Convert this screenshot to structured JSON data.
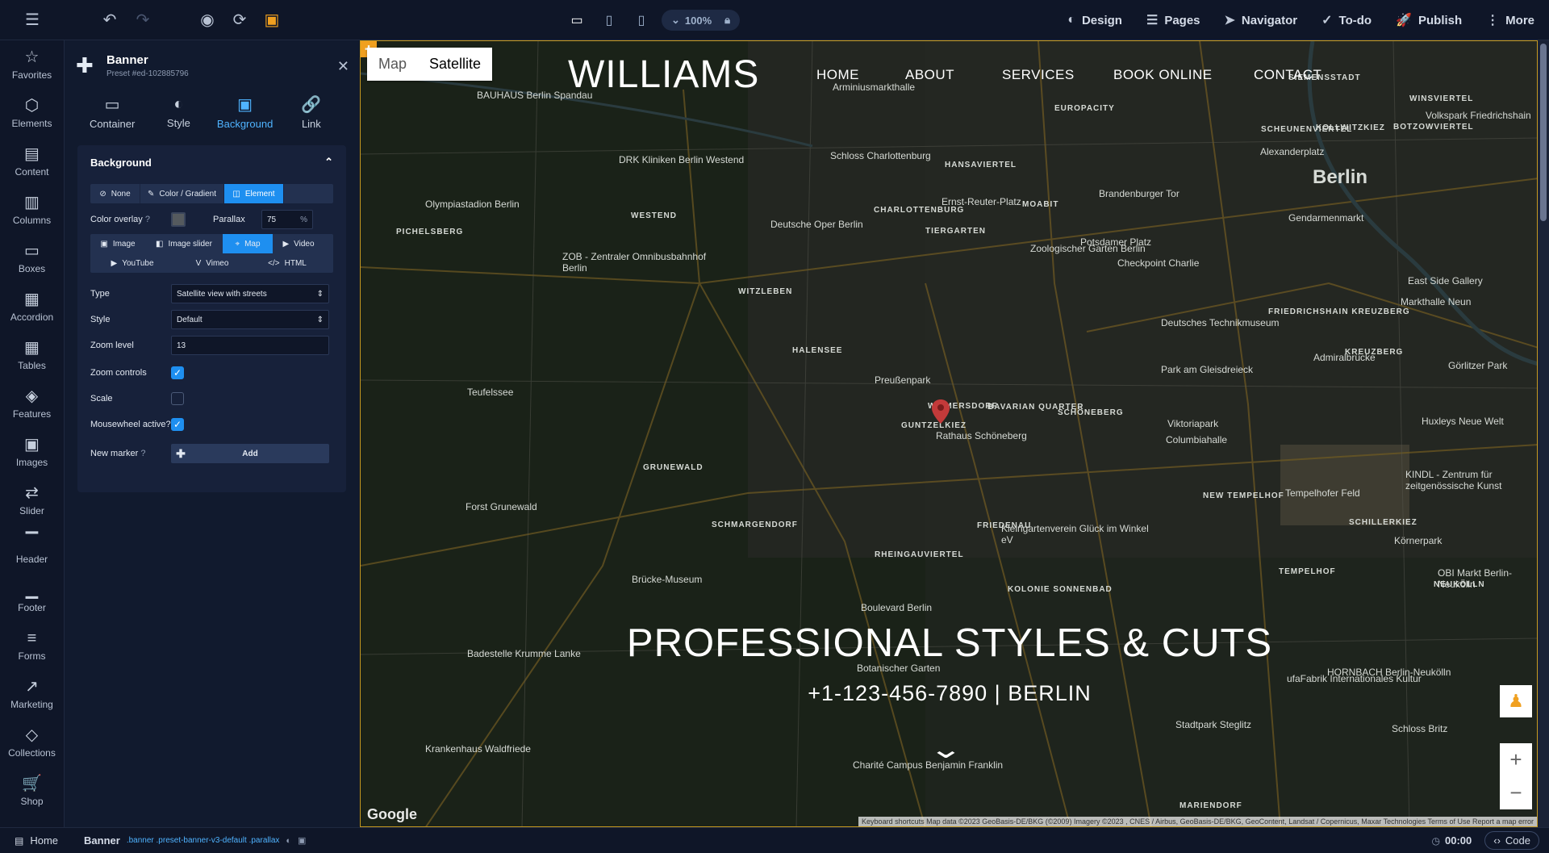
{
  "toolbar": {
    "zoom": "100%",
    "nav": [
      {
        "icon": "palette-icon",
        "glyph": "◐",
        "label": "Design"
      },
      {
        "icon": "pages-icon",
        "glyph": "☰",
        "label": "Pages"
      },
      {
        "icon": "navigator-icon",
        "glyph": "➤",
        "label": "Navigator"
      },
      {
        "icon": "check-circle-icon",
        "glyph": "✓",
        "label": "To-do"
      },
      {
        "icon": "rocket-icon",
        "glyph": "🚀",
        "label": "Publish"
      },
      {
        "icon": "more-icon",
        "glyph": "⋮",
        "label": "More"
      }
    ]
  },
  "rail": [
    {
      "icon": "star-icon",
      "glyph": "☆",
      "label": "Favorites"
    },
    {
      "icon": "cube-icon",
      "glyph": "⬡",
      "label": "Elements"
    },
    {
      "icon": "document-icon",
      "glyph": "▤",
      "label": "Content"
    },
    {
      "icon": "columns-icon",
      "glyph": "▥",
      "label": "Columns"
    },
    {
      "icon": "box-icon",
      "glyph": "▭",
      "label": "Boxes"
    },
    {
      "icon": "accordion-icon",
      "glyph": "▦",
      "label": "Accordion"
    },
    {
      "icon": "table-icon",
      "glyph": "▦",
      "label": "Tables"
    },
    {
      "icon": "features-icon",
      "glyph": "◈",
      "label": "Features"
    },
    {
      "icon": "image-icon",
      "glyph": "▣",
      "label": "Images"
    },
    {
      "icon": "slider-icon",
      "glyph": "⇄",
      "label": "Slider"
    },
    {
      "icon": "header-icon",
      "glyph": "▔",
      "label": "Header"
    },
    {
      "icon": "footer-icon",
      "glyph": "▁",
      "label": "Footer"
    },
    {
      "icon": "forms-icon",
      "glyph": "≡",
      "label": "Forms"
    },
    {
      "icon": "marketing-icon",
      "glyph": "↗",
      "label": "Marketing"
    },
    {
      "icon": "layers-icon",
      "glyph": "◇",
      "label": "Collections"
    },
    {
      "icon": "cart-icon",
      "glyph": "🛒",
      "label": "Shop"
    }
  ],
  "panel": {
    "title": "Banner",
    "subtitle": "Preset #ed-102885796",
    "tabs": [
      {
        "label": "Container",
        "glyph": "▭",
        "icon": "container-icon"
      },
      {
        "label": "Style",
        "glyph": "◐",
        "icon": "palette-icon"
      },
      {
        "label": "Background",
        "glyph": "▣",
        "icon": "background-icon"
      },
      {
        "label": "Link",
        "glyph": "🔗",
        "icon": "link-icon"
      }
    ],
    "section_title": "Background",
    "bg_modes": [
      {
        "label": "None",
        "glyph": "⊘"
      },
      {
        "label": "Color / Gradient",
        "glyph": "✎"
      },
      {
        "label": "Element",
        "glyph": "◫"
      }
    ],
    "color_overlay_label": "Color overlay",
    "parallax_label": "Parallax",
    "parallax_value": "75",
    "parallax_unit": "%",
    "types_row1": [
      {
        "label": "Image",
        "glyph": "▣"
      },
      {
        "label": "Image slider",
        "glyph": "◧"
      },
      {
        "label": "Map",
        "glyph": "⌖"
      },
      {
        "label": "Video",
        "glyph": "▶"
      }
    ],
    "types_row2": [
      {
        "label": "YouTube",
        "glyph": "▶"
      },
      {
        "label": "Vimeo",
        "glyph": "V"
      },
      {
        "label": "HTML",
        "glyph": "</>"
      }
    ],
    "type_label": "Type",
    "type_value": "Satellite view with streets",
    "style_label": "Style",
    "style_value": "Default",
    "zoom_label": "Zoom level",
    "zoom_value": "13",
    "zoom_controls_label": "Zoom controls",
    "scale_label": "Scale",
    "mousewheel_label": "Mousewheel active?",
    "new_marker_label": "New marker",
    "add_label": "Add"
  },
  "site": {
    "logo": "WILLIAMS",
    "nav": [
      "HOME",
      "ABOUT",
      "SERVICES",
      "BOOK ONLINE",
      "CONTACT"
    ],
    "headline": "PROFESSIONAL STYLES & CUTS",
    "subline": "+1-123-456-7890 | BERLIN",
    "map_btn": "Map",
    "sat_btn": "Satellite",
    "google": "Google",
    "attribution": "Keyboard shortcuts   Map data ©2023 GeoBasis-DE/BKG (©2009) Imagery ©2023 , CNES / Airbus, GeoBasis-DE/BKG, GeoContent, Landsat / Copernicus, Maxar Technologies   Terms of Use   Report a map error"
  },
  "map_labels": [
    {
      "t": "Berlin",
      "big": true
    },
    {
      "t": "Schloss Charlottenburg"
    },
    {
      "t": "Olympiastadion Berlin"
    },
    {
      "t": "DRK Kliniken Berlin Westend"
    },
    {
      "t": "Deutsche Oper Berlin"
    },
    {
      "t": "Ernst-Reuter-Platz"
    },
    {
      "t": "Zoologischer Garten Berlin"
    },
    {
      "t": "Brandenburger Tor"
    },
    {
      "t": "Potsdamer Platz"
    },
    {
      "t": "Checkpoint Charlie"
    },
    {
      "t": "Alexanderplatz"
    },
    {
      "t": "Gendarmenmarkt"
    },
    {
      "t": "East Side Gallery"
    },
    {
      "t": "Deutsches Technikmuseum"
    },
    {
      "t": "Rathaus Schöneberg"
    },
    {
      "t": "Viktoriapark"
    },
    {
      "t": "Columbiahalle"
    },
    {
      "t": "Tempelhofer Feld"
    },
    {
      "t": "Teufelssee"
    },
    {
      "t": "Forst Grunewald"
    },
    {
      "t": "Brücke-Museum"
    },
    {
      "t": "Boulevard Berlin"
    },
    {
      "t": "Botanischer Garten"
    },
    {
      "t": "Krankenhaus Waldfriede"
    },
    {
      "t": "Charité Campus Benjamin Franklin"
    },
    {
      "t": "Badestelle Krumme Lanke"
    },
    {
      "t": "ZOB - Zentraler Omnibusbahnhof Berlin"
    },
    {
      "t": "Markthalle Neun"
    },
    {
      "t": "Huxleys Neue Welt"
    },
    {
      "t": "Admiralbrücke"
    },
    {
      "t": "BAUHAUS Berlin Spandau"
    },
    {
      "t": "Preußenpark"
    },
    {
      "t": "Körnerpark"
    },
    {
      "t": "Schloss Britz"
    },
    {
      "t": "KINDL - Zentrum für zeitgenössische Kunst"
    },
    {
      "t": "Kleingartenverein Glück im Winkel eV"
    },
    {
      "t": "ufaFabrik Internationales Kultur"
    },
    {
      "t": "HORNBACH Berlin-Neukölln"
    },
    {
      "t": "Stadtpark Steglitz"
    },
    {
      "t": "OBI Markt Berlin-Neukölln"
    },
    {
      "t": "Volkspark Friedrichshain"
    },
    {
      "t": "Görlitzer Park"
    },
    {
      "t": "Park am Gleisdreieck"
    },
    {
      "t": "Arminiusmarkthalle"
    },
    {
      "t": "SCHÖNEBERG"
    },
    {
      "t": "KREUZBERG"
    },
    {
      "t": "NEUKÖLLN"
    },
    {
      "t": "WILMERSDORF"
    },
    {
      "t": "CHARLOTTENBURG"
    },
    {
      "t": "TIERGARTEN"
    },
    {
      "t": "HALENSEE"
    },
    {
      "t": "WITZLEBEN"
    },
    {
      "t": "PICHELSBERG"
    },
    {
      "t": "WESTEND"
    },
    {
      "t": "GRUNEWALD"
    },
    {
      "t": "SCHMARGENDORF"
    },
    {
      "t": "FRIEDENAU"
    },
    {
      "t": "RHEINGAUVIERTEL"
    },
    {
      "t": "KOLONIE SONNENBAD"
    },
    {
      "t": "NEW TEMPELHOF"
    },
    {
      "t": "SCHILLERKIEZ"
    },
    {
      "t": "GUNTZELKIEZ"
    },
    {
      "t": "BAVARIAN QUARTER"
    },
    {
      "t": "EUROPACITY"
    },
    {
      "t": "MOABIT"
    },
    {
      "t": "HANSAVIERTEL"
    },
    {
      "t": "SCHEUNENVIERTEL"
    },
    {
      "t": "KOLLWITZKIEZ"
    },
    {
      "t": "BOTZOWVIERTEL"
    },
    {
      "t": "WINSVIERTEL"
    },
    {
      "t": "FRIEDRICHSHAIN KREUZBERG"
    },
    {
      "t": "TEMPELHOF"
    },
    {
      "t": "MARIENDORF"
    },
    {
      "t": "SIEMENSSTADT"
    }
  ],
  "bottom": {
    "home": "Home",
    "element": "Banner",
    "classes": ".banner .preset-banner-v3-default .parallax",
    "timer": "00:00",
    "code": "Code"
  }
}
